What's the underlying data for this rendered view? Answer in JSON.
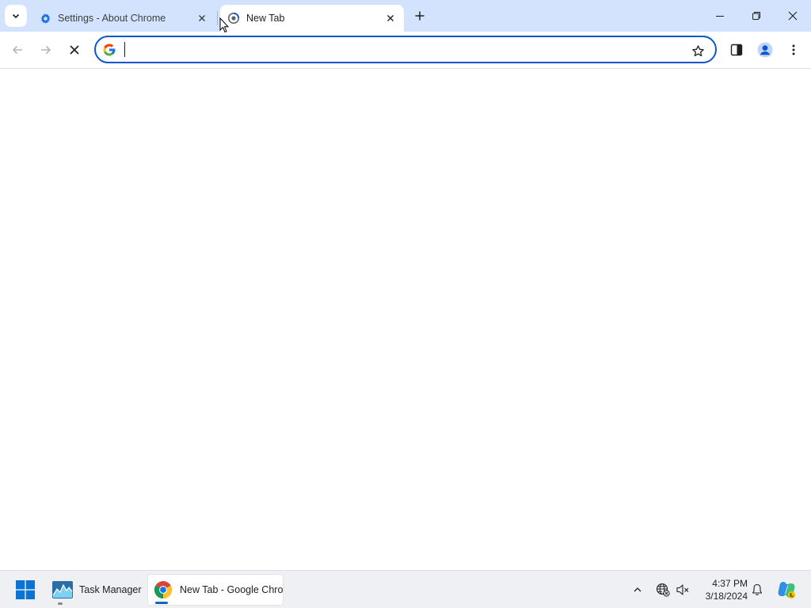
{
  "tabs": [
    {
      "title": "Settings - About Chrome",
      "icon": "gear-icon",
      "active": false
    },
    {
      "title": "New Tab",
      "icon": "chrome-loading-icon",
      "active": true
    }
  ],
  "toolbar": {
    "omnibox_value": "",
    "omnibox_placeholder": ""
  },
  "taskbar": {
    "apps": [
      {
        "label": "Task Manager",
        "icon": "task-manager-icon"
      },
      {
        "label": "New Tab - Google Chrome",
        "icon": "chrome-icon"
      }
    ],
    "clock": {
      "time": "4:37 PM",
      "date": "3/18/2024"
    }
  },
  "colors": {
    "tabstrip_bg": "#d3e3fd",
    "accent": "#0b57d0",
    "taskbar_bg": "#eef0f4"
  }
}
